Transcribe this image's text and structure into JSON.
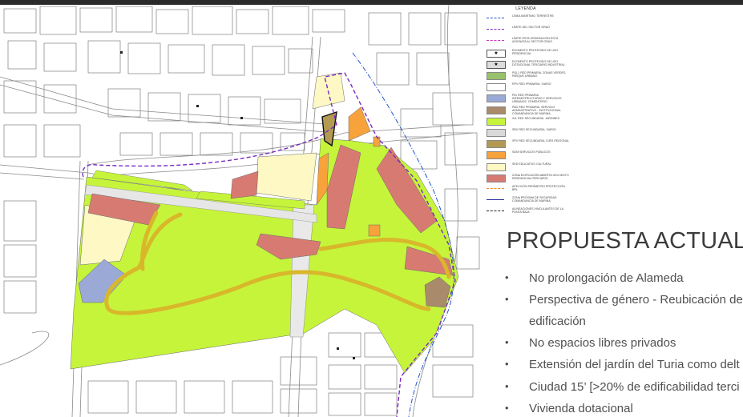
{
  "slide": {
    "title": "PROPUESTA ACTUAL",
    "bullets": [
      "No prolongación de Alameda",
      "Perspectiva de género - Reubicación de",
      "edificación",
      "No espacios libres privados",
      "Extensión del jardín del Turia como delt",
      "Ciudad 15’ [>20% de edificabilidad terci",
      "Vivienda dotacional"
    ],
    "bullet_marks": [
      "•",
      "•",
      "",
      "•",
      "•",
      "•",
      "•"
    ]
  },
  "legend": {
    "title": "LEYENDA",
    "items": [
      {
        "label": "LÍNEA MARÍTIMO TERRESTRE",
        "symbol": "dashdot-line",
        "color": "#2255cc"
      },
      {
        "label": "LÍMITE DEL SECTOR GRAO",
        "symbol": "dashed-line",
        "color": "#7a2bbf"
      },
      {
        "label": "LÍMITE ESTA ORDENACIÓN ESTÁ ASIGNATA AL SECTOR GRAO",
        "symbol": "dashed-line",
        "color": "#d12fbf"
      },
      {
        "label": "ELEMENTO PROTEGIDO DE USO RESIDENCIAL",
        "symbol": "star-box",
        "color": "#ffffff"
      },
      {
        "label": "ELEMENTO PROTEGIDO DE USO DOTACIONAL TERCIARIO INDUSTRIAL",
        "symbol": "star-box",
        "color": "#dddddd"
      },
      {
        "label": "PQL1 RED PRIMARIA. ZONAS VERDES. PARQUE URBANO",
        "symbol": "fill",
        "color": "#97c16b"
      },
      {
        "label": "RPV RED PRIMARIA. VIARIO",
        "symbol": "fill",
        "color": "#ffffff"
      },
      {
        "label": "PID RED PRIMARIA. INFRAESTRUCTURAS Y SERVICIOS URBANOS. CEMENTERIO",
        "symbol": "fill",
        "color": "#9aa9d6"
      },
      {
        "label": "PAD RED PRIMARIA. SERVICIO ADMINISTRATIVO - INSTITUCIONAL COMANDANCIA DE MARINA",
        "symbol": "fill",
        "color": "#a98a6a"
      },
      {
        "label": "SJL RED SECUNDARIA. JARDINES",
        "symbol": "fill",
        "color": "#c6f43b"
      },
      {
        "label": "SRV RED SECUNDARIA. VIARIO",
        "symbol": "fill",
        "color": "#d9d9d9"
      },
      {
        "label": "SPV RED SECUNDARIA. EJES PEATONAL",
        "symbol": "fill",
        "color": "#b39a52"
      },
      {
        "label": "SDM SERVICIOS PÚBLICOS",
        "symbol": "fill",
        "color": "#f7a23a"
      },
      {
        "label": "SED EDUCATIVO CULTURAL",
        "symbol": "fill",
        "color": "#fdf8c4"
      },
      {
        "label": "ZONA EDIFICACIÓN ABIERTA USO MIXTO RESIDENCIAL/TERCIARIO",
        "symbol": "fill",
        "color": "#d77b72"
      },
      {
        "label": "AFECCIÓN PERÍMETRO PROTECCIÓN BRL",
        "symbol": "dashed-line",
        "color": "#f08a2a"
      },
      {
        "label": "ZONA PRÓXIMA DE SEGURIDAD COMANDANCIA DE MARINA",
        "symbol": "solid-line",
        "color": "#2c2c9a"
      },
      {
        "label": "ALINEACIONES VINCULANTES DE LA PUNTA BAJA",
        "symbol": "dashed-line",
        "color": "#222222"
      }
    ]
  },
  "colors": {
    "jardines": "#c6f43b",
    "edificacion": "#d77b72",
    "servicios": "#f7a23a",
    "educativo": "#fdf8c4",
    "infraestructura": "#9aa9d6",
    "paseo": "#d9b72a",
    "sector_limit": "#7a2bbf",
    "coast_line": "#2255cc"
  }
}
